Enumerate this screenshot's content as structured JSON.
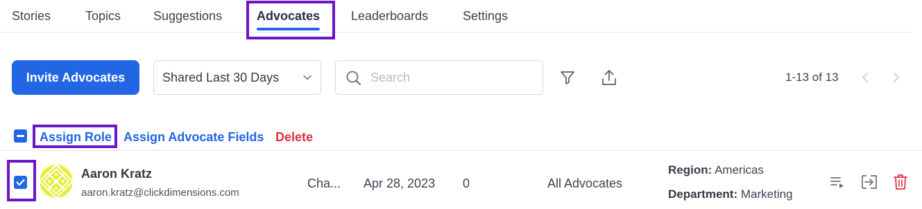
{
  "tabs": [
    {
      "label": "Stories"
    },
    {
      "label": "Topics"
    },
    {
      "label": "Suggestions"
    },
    {
      "label": "Advocates",
      "active": true
    },
    {
      "label": "Leaderboards"
    },
    {
      "label": "Settings"
    }
  ],
  "toolbar": {
    "invite_label": "Invite Advocates",
    "filter_select_value": "Shared Last 30 Days",
    "search_placeholder": "Search",
    "pagination_text": "1-13 of 13",
    "icons": [
      "search-icon",
      "filter-icon",
      "export-icon",
      "chevron-left-icon",
      "chevron-right-icon"
    ]
  },
  "bulk_actions": {
    "assign_role": "Assign Role",
    "assign_fields": "Assign Advocate Fields",
    "delete": "Delete"
  },
  "rows": [
    {
      "name": "Aaron Kratz",
      "email": "aaron.kratz@clickdimensions.com",
      "role": "Cha...",
      "date": "Apr 28, 2023",
      "count": "0",
      "group": "All Advocates",
      "region_label": "Region:",
      "region_value": "Americas",
      "department_label": "Department:",
      "department_value": "Marketing",
      "checked": true
    }
  ],
  "colors": {
    "accent": "#2266e3",
    "danger": "#dc2f44",
    "highlight": "#6b16c9",
    "avatar_bg": "#e6ef3a"
  }
}
